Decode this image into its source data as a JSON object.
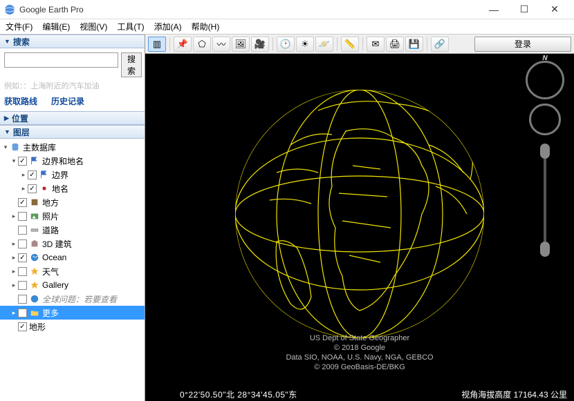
{
  "app": {
    "title": "Google Earth Pro"
  },
  "menu": {
    "file": "文件(F)",
    "edit": "编辑(E)",
    "view": "视图(V)",
    "tools": "工具(T)",
    "add": "添加(A)",
    "help": "帮助(H)"
  },
  "panels": {
    "search": {
      "title": "搜索",
      "button": "搜索",
      "hint": "例如：：上海附近的汽车加油",
      "directions": "获取路线",
      "history": "历史记录"
    },
    "places": {
      "title": "位置"
    },
    "layers": {
      "title": "图层"
    }
  },
  "layers": {
    "root": "主数据库",
    "bordersAndLabels": "边界和地名",
    "borders": "边界",
    "labels": "地名",
    "places": "地方",
    "photos": "照片",
    "roads": "道路",
    "buildings3d": "3D 建筑",
    "ocean": "Ocean",
    "weather": "天气",
    "gallery": "Gallery",
    "globalAwareness": "全球问题：若要查看",
    "more": "更多",
    "terrain": "地形"
  },
  "toolbar": {
    "login": "登录"
  },
  "credits": {
    "l1": "US Dept of State Geographer",
    "l2": "© 2018 Google",
    "l3": "Data SIO, NOAA, U.S. Navy, NGA, GEBCO",
    "l4": "© 2009 GeoBasis-DE/BKG"
  },
  "status": {
    "coords": "0°22'50.50\"北  28°34'45.05\"东",
    "elev": "视角海拔高度 17164.43 公里"
  }
}
